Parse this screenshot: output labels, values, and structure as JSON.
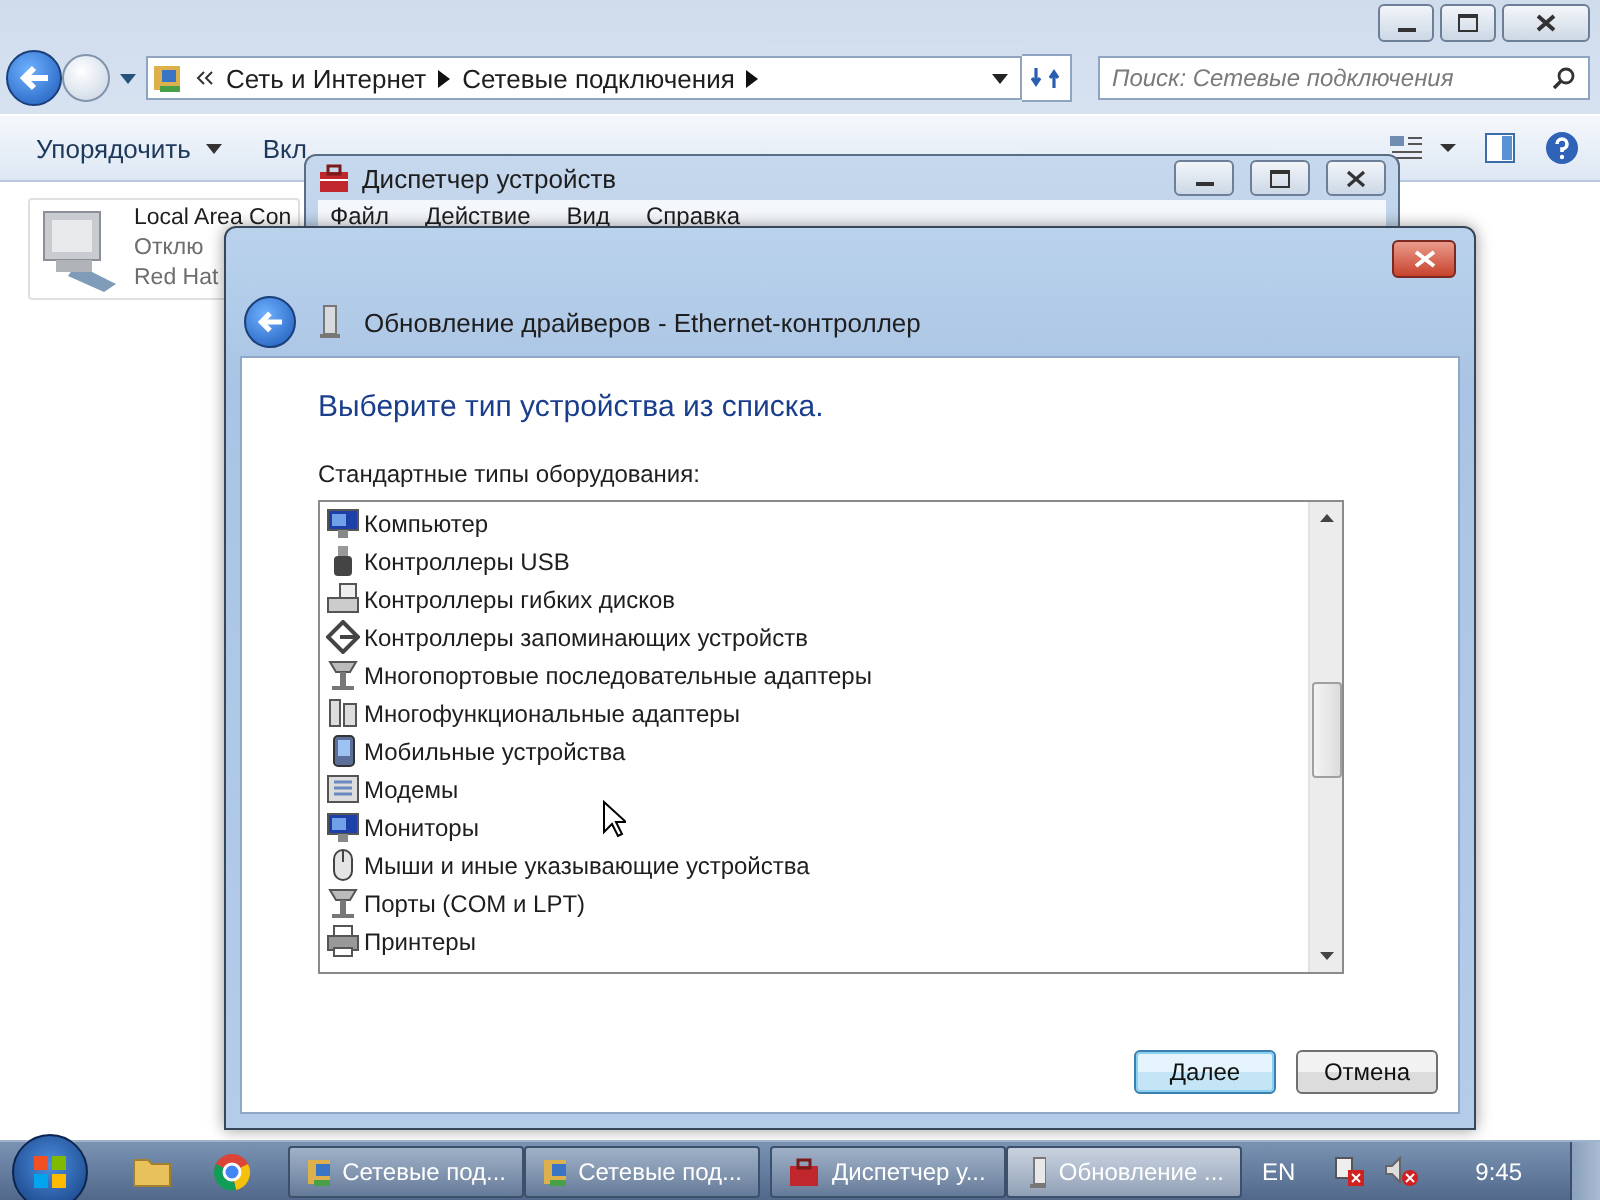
{
  "explorer": {
    "address": [
      "Сеть и Интернет",
      "Сетевые подключения"
    ],
    "search": {
      "placeholder": "Поиск: Сетевые подключения"
    },
    "toolbar": [
      "Упорядочить",
      "Вкл"
    ],
    "item": {
      "name": "Local Area Con",
      "status": "Отклю",
      "adapter": "Red Hat"
    }
  },
  "device_manager": {
    "title": "Диспетчер устройств",
    "menu": [
      "Файл",
      "Действие",
      "Вид",
      "Справка"
    ]
  },
  "dialog": {
    "title": "Обновление драйверов - Ethernet-контроллер",
    "heading": "Выберите тип устройства из списка.",
    "list_label": "Стандартные типы оборудования:",
    "items": [
      {
        "label": "Компьютер",
        "kind": "computer",
        "selected": false
      },
      {
        "label": "Контроллеры USB",
        "kind": "usb",
        "selected": false
      },
      {
        "label": "Контроллеры гибких дисков",
        "kind": "floppy",
        "selected": false
      },
      {
        "label": "Контроллеры запоминающих устройств",
        "kind": "storage",
        "selected": false
      },
      {
        "label": "Многопортовые последовательные адаптеры",
        "kind": "port",
        "selected": false
      },
      {
        "label": "Многофункциональные адаптеры",
        "kind": "card",
        "selected": false
      },
      {
        "label": "Мобильные устройства",
        "kind": "mobile",
        "selected": false
      },
      {
        "label": "Модемы",
        "kind": "modem",
        "selected": false
      },
      {
        "label": "Мониторы",
        "kind": "computer",
        "selected": false
      },
      {
        "label": "Мыши и иные указывающие устройства",
        "kind": "mouse",
        "selected": false
      },
      {
        "label": "Порты (COM и LPT)",
        "kind": "port",
        "selected": false
      },
      {
        "label": "Принтеры",
        "kind": "printer",
        "selected": false
      }
    ],
    "buttons": [
      {
        "label": "Далее",
        "default": true
      },
      {
        "label": "Отмена",
        "default": false
      }
    ]
  },
  "taskbar": {
    "tasks": [
      {
        "label": "Сетевые под...",
        "kind": "network",
        "active": false
      },
      {
        "label": "Сетевые под...",
        "kind": "network",
        "active": false
      },
      {
        "label": "Диспетчер у...",
        "kind": "manager",
        "active": false
      },
      {
        "label": "Обновление ...",
        "kind": "device",
        "active": true
      }
    ],
    "language": "EN",
    "time": "9:45"
  }
}
